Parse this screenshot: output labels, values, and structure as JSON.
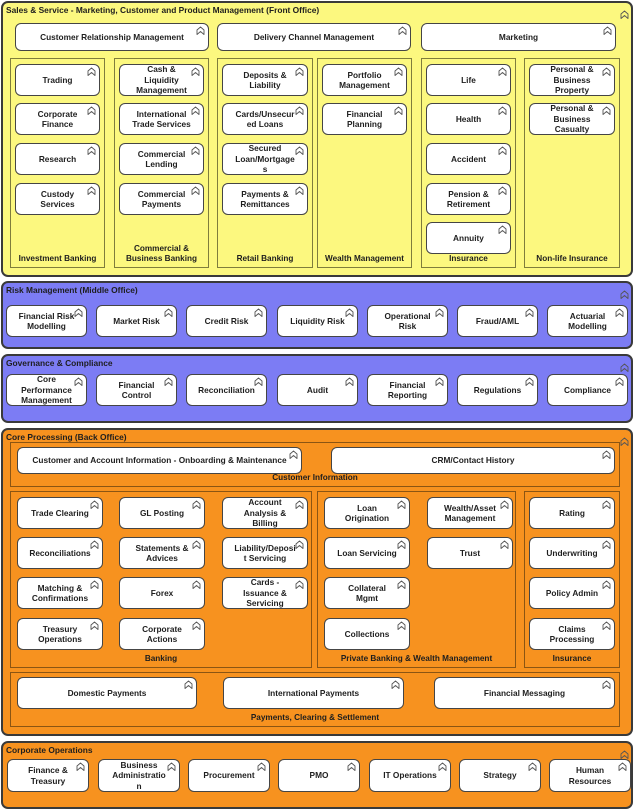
{
  "sections": {
    "front_office": {
      "title": "Sales & Service - Marketing, Customer and Product Management (Front Office)",
      "top_boxes": [
        "Customer Relationship Management",
        "Delivery Channel Management",
        "Marketing"
      ],
      "groups": [
        {
          "label": "Investment Banking",
          "items": [
            "Trading",
            "Corporate Finance",
            "Research",
            "Custody Services"
          ]
        },
        {
          "label": "Commercial & Business Banking",
          "items": [
            "Cash & Liquidity Management",
            "International Trade Services",
            "Commercial Lending",
            "Commercial Payments"
          ]
        },
        {
          "label": "Retail Banking",
          "items": [
            "Deposits & Liability",
            "Cards/Unsecured Loans",
            "Secured Loan/Mortgages",
            "Payments & Remittances"
          ]
        },
        {
          "label": "Wealth Management",
          "items": [
            "Portfolio Management",
            "Financial Planning"
          ]
        },
        {
          "label": "Insurance",
          "items": [
            "Life",
            "Health",
            "Accident",
            "Pension & Retirement",
            "Annuity"
          ]
        },
        {
          "label": "Non-life Insurance",
          "items": [
            "Personal & Business Property",
            "Personal & Business Casualty"
          ]
        }
      ]
    },
    "risk": {
      "title": "Risk Management (Middle Office)",
      "items": [
        "Financial Risk Modelling",
        "Market Risk",
        "Credit Risk",
        "Liquidity Risk",
        "Operational Risk",
        "Fraud/AML",
        "Actuarial Modelling"
      ]
    },
    "governance": {
      "title": "Governance & Compliance",
      "items": [
        "Core Performance Management",
        "Financial Control",
        "Reconciliation",
        "Audit",
        "Financial Reporting",
        "Regulations",
        "Compliance"
      ]
    },
    "core": {
      "title": "Core Processing (Back Office)",
      "groups": [
        {
          "label": "Customer Information",
          "items": [
            "Customer and Account Information - Onboarding & Maintenance",
            "CRM/Contact History"
          ]
        },
        {
          "label": "Banking",
          "items": [
            "Trade Clearing",
            "GL Posting",
            "Account Analysis & Billing",
            "Reconciliations",
            "Statements & Advices",
            "Liability/Deposit Servicing",
            "Matching & Confirmations",
            "Forex",
            "Cards - Issuance & Servicing",
            "Treasury Operations",
            "Corporate Actions"
          ]
        },
        {
          "label": "Private Banking & Wealth Management",
          "items": [
            "Loan Origination",
            "Wealth/Asset Management",
            "Loan Servicing",
            "Trust",
            "Collateral Mgmt",
            "Collections"
          ]
        },
        {
          "label": "Insurance",
          "items": [
            "Rating",
            "Underwriting",
            "Policy Admin",
            "Claims Processing"
          ]
        },
        {
          "label": "Payments, Clearing & Settlement",
          "items": [
            "Domestic Payments",
            "International Payments",
            "Financial Messaging"
          ]
        }
      ]
    },
    "corporate": {
      "title": "Corporate Operations",
      "items": [
        "Finance & Treasury",
        "Business Administration",
        "Procurement",
        "PMO",
        "IT Operations",
        "Strategy",
        "Human Resources"
      ]
    }
  },
  "icons": {
    "element_icon": "business-function-icon"
  },
  "colors": {
    "front_office": "#fcf87f",
    "middle_office": "#7c7cf4",
    "back_office": "#f7921f",
    "element_fill": "#ffffff"
  }
}
